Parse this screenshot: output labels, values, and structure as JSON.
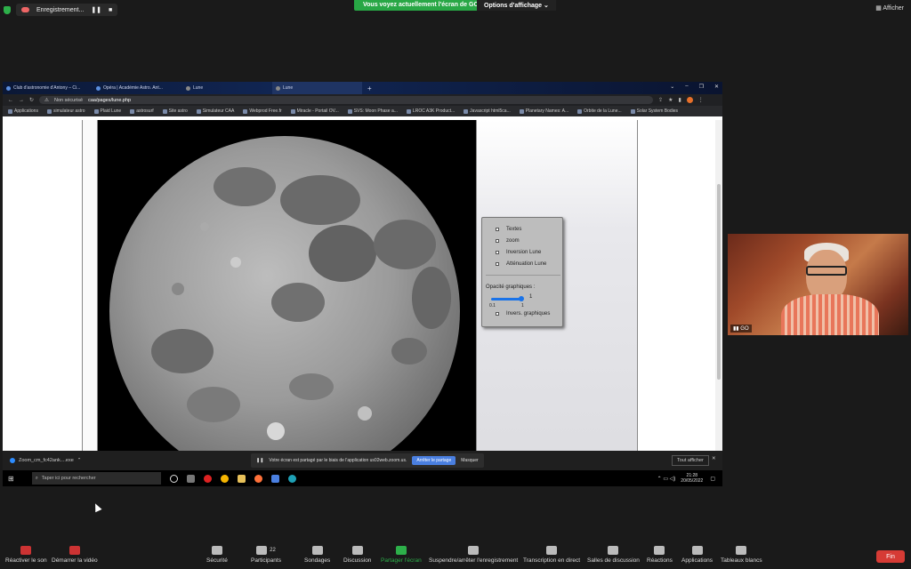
{
  "zoom": {
    "recording": {
      "label": "Enregistrement..."
    },
    "share_banner": "Vous voyez actuellement l'écran de GO",
    "view_options": "Options d'affichage ⌄",
    "show_button": "Afficher",
    "participant_name": "GO",
    "share_note": "Votre écran est partagé par le biais de l'application us02web.zoom.us.",
    "stop_share_label": "Arrêter le partage",
    "hide_label": "Masquer",
    "end_label": "Fin",
    "toolbar": [
      {
        "label": "Réactiver le son",
        "icon": "mic-muted-icon"
      },
      {
        "label": "Démarrer la vidéo",
        "icon": "video-off-icon"
      },
      {
        "label": "Sécurité",
        "icon": "shield-icon"
      },
      {
        "label": "Participants",
        "icon": "participants-icon",
        "count": "22"
      },
      {
        "label": "Sondages",
        "icon": "polls-icon"
      },
      {
        "label": "Discussion",
        "icon": "chat-icon"
      },
      {
        "label": "Partager l'écran",
        "icon": "share-screen-icon"
      },
      {
        "label": "Suspendre/arrêter l'enregistrement",
        "icon": "pause-stop-icon"
      },
      {
        "label": "Transcription en direct",
        "icon": "cc-icon"
      },
      {
        "label": "Salles de discussion",
        "icon": "breakout-icon"
      },
      {
        "label": "Réactions",
        "icon": "reactions-icon"
      },
      {
        "label": "Applications",
        "icon": "apps-icon"
      },
      {
        "label": "Tableaux blancs",
        "icon": "whiteboard-icon"
      }
    ]
  },
  "browser": {
    "tabs": [
      {
        "label": "Club d'astronomie d'Antony – Ci..."
      },
      {
        "label": "Opéra | Académie Astro. Ant..."
      },
      {
        "label": "Lune"
      },
      {
        "label": "Lune"
      }
    ],
    "security": "Non sécurisé",
    "url": "caa/pages/lune.php",
    "bookmarks": [
      "Applications",
      "simulateur astro",
      "Plaid Lune",
      "astrosurf",
      "Site astro",
      "Simulateur CAA",
      "Webprod Free.fr",
      "Miracle - Portail OV...",
      "SVS: Moon Phase a...",
      "LROC A3K Product...",
      "Javascript html5ca...",
      "Planetary Names: A...",
      "Orbite de la Lune...",
      "Solar System Bodies"
    ]
  },
  "panel": {
    "options": [
      {
        "label": "Textes",
        "checked": false
      },
      {
        "label": "zoom",
        "checked": false
      },
      {
        "label": "Inversion Lune",
        "checked": false
      },
      {
        "label": "Atténuation Lune",
        "checked": false
      }
    ],
    "opacity_label": "Opacité graphiques :",
    "opacity_value": "1",
    "opacity_min": "0.1",
    "opacity_max": "1",
    "invert_label": "Invers. graphiques"
  },
  "windows": {
    "download_file": "Zoom_cm_fc42ank....exe",
    "show_all": "Tout afficher",
    "search_placeholder": "Taper ici pour rechercher",
    "time": "21:28",
    "date": "20/05/2022"
  },
  "colors": {
    "accent": "#2db04a",
    "end": "#d63b35",
    "slider": "#1a73e8"
  }
}
